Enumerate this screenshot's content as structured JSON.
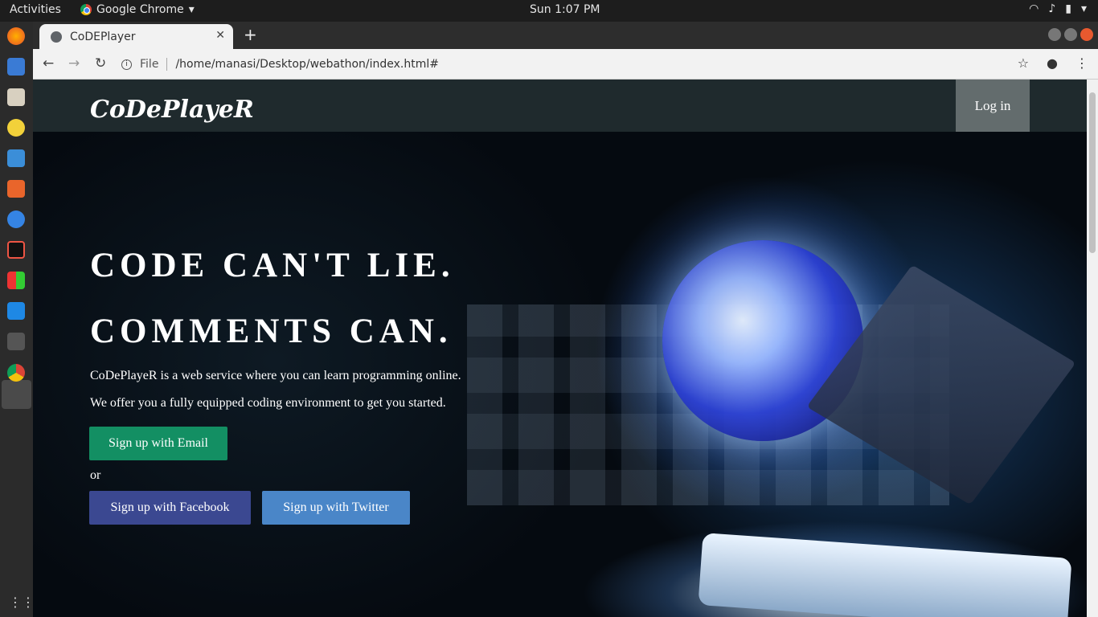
{
  "system": {
    "activities": "Activities",
    "app_name": "Google Chrome",
    "clock": "Sun  1:07 PM"
  },
  "browser": {
    "tab_title": "CoDEPlayer",
    "url_scheme": "File",
    "url": "/home/manasi/Desktop/webathon/index.html#"
  },
  "site": {
    "brand": "CoDePlayeR",
    "login_label": "Log in",
    "headline_1": "CODE CAN'T LIE.",
    "headline_2": "COMMENTS CAN.",
    "paragraph_1": "CoDePlayeR is a web service where you can learn programming online.",
    "paragraph_2": "We offer you a fully equipped coding environment to get you started.",
    "signup_email": "Sign up with Email",
    "or_text": "or",
    "signup_facebook": "Sign up with Facebook",
    "signup_twitter": "Sign up with Twitter"
  },
  "colors": {
    "nav_bg": "#1f2a2d",
    "login_bg": "#636c6d",
    "email_btn": "#138f63",
    "facebook_btn": "#3b4891",
    "twitter_btn": "#4a86c8"
  }
}
